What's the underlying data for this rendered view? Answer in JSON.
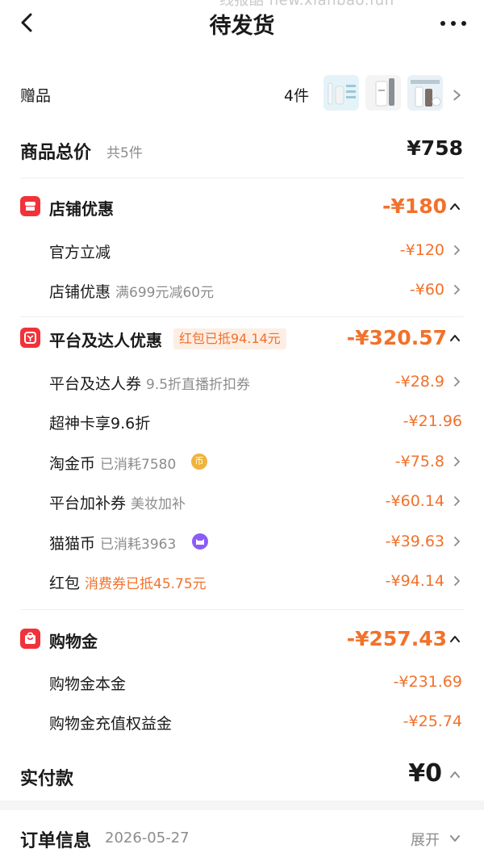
{
  "watermark": "线报酷 new.xianbao.fun",
  "header": {
    "title": "待发货"
  },
  "gift": {
    "label": "赠品",
    "count": "4件"
  },
  "total": {
    "label": "商品总价",
    "count_note": "共5件",
    "amount": "¥758"
  },
  "store_discount": {
    "title": "店铺优惠",
    "amount": "-¥180",
    "items": [
      {
        "label": "官方立减",
        "note": "",
        "amount": "-¥120"
      },
      {
        "label": "店铺优惠",
        "note": "满699元减60元",
        "amount": "-¥60"
      }
    ]
  },
  "platform_discount": {
    "title": "平台及达人优惠",
    "tag": "红包已抵94.14元",
    "amount": "-¥320.57",
    "items": [
      {
        "label": "平台及达人券",
        "note": "9.5折直播折扣券",
        "amount": "-¥28.9"
      },
      {
        "label": "超神卡享9.6折",
        "note": "",
        "amount": "-¥21.96"
      },
      {
        "label": "淘金币",
        "note": "已消耗7580",
        "badge": "币",
        "amount": "-¥75.8"
      },
      {
        "label": "平台加补券",
        "note": "美妆加补",
        "amount": "-¥60.14"
      },
      {
        "label": "猫猫币",
        "note": "已消耗3963",
        "amount": "-¥39.63"
      },
      {
        "label": "红包",
        "note": "消费券已抵45.75元",
        "amount": "-¥94.14"
      }
    ]
  },
  "shopping_money": {
    "title": "购物金",
    "amount": "-¥257.43",
    "items": [
      {
        "label": "购物金本金",
        "amount": "-¥231.69"
      },
      {
        "label": "购物金充值权益金",
        "amount": "-¥25.74"
      }
    ]
  },
  "paid": {
    "label": "实付款",
    "amount": "¥0"
  },
  "order_info": {
    "label": "订单信息",
    "date": "2026-05-27",
    "expand": "展开"
  },
  "colors": {
    "accent": "#f2712b",
    "icon_red": "#f1323a",
    "muted": "#8c8c8c"
  }
}
